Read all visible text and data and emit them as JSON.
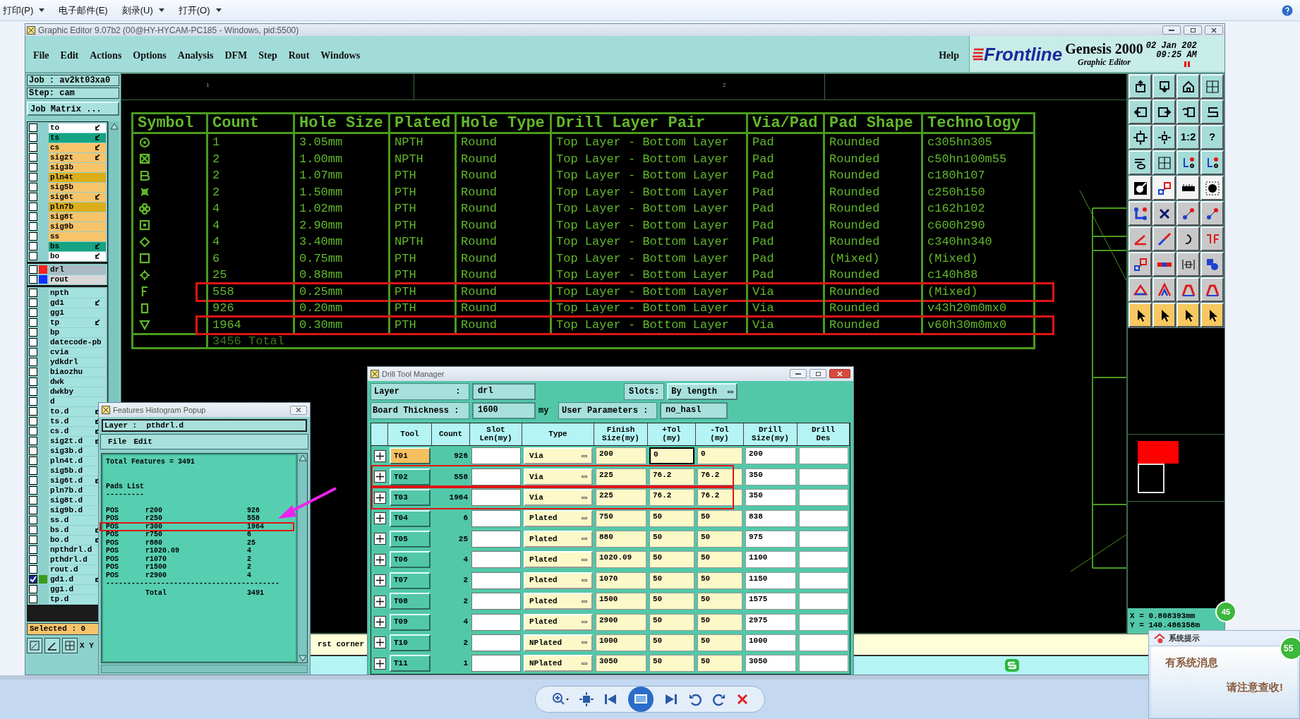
{
  "viewer_toolbar": {
    "items": [
      {
        "label": "打印(P)",
        "dropdown": true
      },
      {
        "label": "电子邮件(E)",
        "dropdown": false
      },
      {
        "label": "刻录(U)",
        "dropdown": true
      },
      {
        "label": "打开(O)",
        "dropdown": true
      }
    ]
  },
  "window": {
    "title": "Graphic Editor 9.07b2 (00@HY-HYCAM-PC185 - Windows, pid:5500)"
  },
  "menu": [
    "File",
    "Edit",
    "Actions",
    "Options",
    "Analysis",
    "DFM",
    "Step",
    "Rout",
    "Windows"
  ],
  "help": "Help",
  "branding": {
    "logo": "Frontline",
    "product": "Genesis 2000",
    "subtitle": "Graphic Editor",
    "date": "02 Jan 202",
    "time": "09:25 AM"
  },
  "job": {
    "job": "Job : av2kt03xa0",
    "step": "Step: cam",
    "matrix_button": "Job Matrix ..."
  },
  "layer_groups": [
    [
      {
        "name": "to",
        "color": "#ffffff",
        "linked": true,
        "checked": false
      },
      {
        "name": "ts",
        "color": "#16a383",
        "linked": true,
        "checked": false
      },
      {
        "name": "cs",
        "color": "#f8c46a",
        "linked": true,
        "checked": false
      },
      {
        "name": "sig2t",
        "color": "#f8c46a",
        "linked": true,
        "checked": false
      },
      {
        "name": "sig3b",
        "color": "#f8c46a",
        "linked": false,
        "checked": false
      },
      {
        "name": "pln4t",
        "color": "#dcae1a",
        "linked": false,
        "checked": false
      },
      {
        "name": "sig5b",
        "color": "#f8c46a",
        "linked": false,
        "checked": false
      },
      {
        "name": "sig6t",
        "color": "#f8c46a",
        "linked": true,
        "checked": false
      },
      {
        "name": "pln7b",
        "color": "#dcae1a",
        "linked": false,
        "checked": false
      },
      {
        "name": "sig8t",
        "color": "#f8c46a",
        "linked": false,
        "checked": false
      },
      {
        "name": "sig9b",
        "color": "#f8c46a",
        "linked": false,
        "checked": false
      },
      {
        "name": "ss",
        "color": "#f8c46a",
        "linked": false,
        "checked": false
      },
      {
        "name": "bs",
        "color": "#16a383",
        "linked": true,
        "checked": false
      },
      {
        "name": "bo",
        "color": "#ffffff",
        "linked": true,
        "checked": false
      }
    ],
    [
      {
        "name": "drl",
        "color": "#a9bcc4",
        "swatch": {
          "color": "#ff2020"
        },
        "linked": false,
        "checked": false
      },
      {
        "name": "rout",
        "color": "#d8d8d8",
        "swatch": {
          "color": "#1030ff"
        },
        "linked": false,
        "checked": false
      }
    ],
    [
      {
        "name": "npth",
        "color": "#a4e2e0",
        "linked": false,
        "checked": false
      },
      {
        "name": "gd1",
        "color": "#a4e2e0",
        "linked": true,
        "checked": false
      },
      {
        "name": "gg1",
        "color": "#a4e2e0",
        "linked": false,
        "checked": false
      },
      {
        "name": "tp",
        "color": "#a4e2e0",
        "linked": true,
        "checked": false
      },
      {
        "name": "bp",
        "color": "#a4e2e0",
        "linked": false,
        "checked": false
      },
      {
        "name": "datecode-pb",
        "color": "#a4e2e0",
        "linked": false,
        "checked": false
      },
      {
        "name": "cvia",
        "color": "#a4e2e0",
        "linked": false,
        "checked": false
      },
      {
        "name": "ydkdrl",
        "color": "#a4e2e0",
        "linked": false,
        "checked": false
      },
      {
        "name": "biaozhu",
        "color": "#a4e2e0",
        "linked": false,
        "checked": false
      },
      {
        "name": "dwk",
        "color": "#a4e2e0",
        "linked": false,
        "checked": false
      },
      {
        "name": "dwkby",
        "color": "#a4e2e0",
        "linked": false,
        "checked": false
      },
      {
        "name": "d",
        "color": "#a4e2e0",
        "linked": false,
        "checked": false
      },
      {
        "name": "to.d",
        "color": "#a4e2e0",
        "linked": true,
        "checked": false
      },
      {
        "name": "ts.d",
        "color": "#a4e2e0",
        "linked": true,
        "checked": false
      },
      {
        "name": "cs.d",
        "color": "#a4e2e0",
        "linked": true,
        "checked": false
      },
      {
        "name": "sig2t.d",
        "color": "#a4e2e0",
        "linked": true,
        "checked": false
      },
      {
        "name": "sig3b.d",
        "color": "#a4e2e0",
        "linked": false,
        "checked": false
      },
      {
        "name": "pln4t.d",
        "color": "#a4e2e0",
        "linked": false,
        "checked": false
      },
      {
        "name": "sig5b.d",
        "color": "#a4e2e0",
        "linked": false,
        "checked": false
      },
      {
        "name": "sig6t.d",
        "color": "#a4e2e0",
        "linked": true,
        "checked": false
      },
      {
        "name": "pln7b.d",
        "color": "#a4e2e0",
        "linked": false,
        "checked": false
      },
      {
        "name": "sig8t.d",
        "color": "#a4e2e0",
        "linked": false,
        "checked": false
      },
      {
        "name": "sig9b.d",
        "color": "#a4e2e0",
        "linked": false,
        "checked": false
      },
      {
        "name": "ss.d",
        "color": "#a4e2e0",
        "linked": false,
        "checked": false
      },
      {
        "name": "bs.d",
        "color": "#a4e2e0",
        "linked": true,
        "checked": false
      },
      {
        "name": "bo.d",
        "color": "#a4e2e0",
        "linked": true,
        "checked": false
      },
      {
        "name": "npthdrl.d",
        "color": "#a4e2e0",
        "linked": false,
        "checked": false
      },
      {
        "name": "pthdrl.d",
        "color": "#a4e2e0",
        "linked": false,
        "checked": false
      },
      {
        "name": "rout.d",
        "color": "#a4e2e0",
        "linked": false,
        "checked": false
      },
      {
        "name": "gd1.d",
        "color": "#a4e2e0",
        "swatch": {
          "color": "#3a9a1a"
        },
        "linked": true,
        "checked": true
      },
      {
        "name": "gg1.d",
        "color": "#a4e2e0",
        "linked": false,
        "checked": false
      },
      {
        "name": "tp.d",
        "color": "#a4e2e0",
        "linked": false,
        "checked": false
      }
    ]
  ],
  "selected_status": "Selected : 0",
  "xy_label": "X Y",
  "ruler": [
    "1",
    "2"
  ],
  "drill_table": {
    "columns": [
      "Symbol",
      "Count",
      "Hole Size",
      "Plated",
      "Hole Type",
      "Drill Layer Pair",
      "Via/Pad",
      "Pad Shape",
      "Technology"
    ],
    "rows": [
      {
        "kind": "ring",
        "cells": [
          "",
          "1",
          "3.05mm",
          "NPTH",
          "Round",
          "Top Layer - Bottom Layer",
          "Pad",
          "Rounded",
          "c305hn305"
        ],
        "highlighted": false
      },
      {
        "kind": "crossed-square",
        "cells": [
          "",
          "2",
          "1.00mm",
          "NPTH",
          "Round",
          "Top Layer - Bottom Layer",
          "Pad",
          "Rounded",
          "c50hn100m55"
        ],
        "highlighted": false
      },
      {
        "kind": "b-shape",
        "cells": [
          "",
          "2",
          "1.07mm",
          "PTH",
          "Round",
          "Top Layer - Bottom Layer",
          "Pad",
          "Rounded",
          "c180h107"
        ],
        "highlighted": false
      },
      {
        "kind": "cross",
        "cells": [
          "",
          "2",
          "1.50mm",
          "PTH",
          "Round",
          "Top Layer - Bottom Layer",
          "Pad",
          "Rounded",
          "c250h150"
        ],
        "highlighted": false
      },
      {
        "kind": "clover",
        "cells": [
          "",
          "4",
          "1.02mm",
          "PTH",
          "Round",
          "Top Layer - Bottom Layer",
          "Pad",
          "Rounded",
          "c162h102"
        ],
        "highlighted": false
      },
      {
        "kind": "dotted-square",
        "cells": [
          "",
          "4",
          "2.90mm",
          "PTH",
          "Round",
          "Top Layer - Bottom Layer",
          "Pad",
          "Rounded",
          "c600h290"
        ],
        "highlighted": false
      },
      {
        "kind": "diamond",
        "cells": [
          "",
          "4",
          "3.40mm",
          "NPTH",
          "Round",
          "Top Layer - Bottom Layer",
          "Pad",
          "Rounded",
          "c340hn340"
        ],
        "highlighted": false
      },
      {
        "kind": "square",
        "cells": [
          "",
          "6",
          "0.75mm",
          "PTH",
          "Round",
          "Top Layer - Bottom Layer",
          "Pad",
          "(Mixed)",
          "(Mixed)"
        ],
        "highlighted": false
      },
      {
        "kind": "star",
        "cells": [
          "",
          "25",
          "0.88mm",
          "PTH",
          "Round",
          "Top Layer - Bottom Layer",
          "Pad",
          "Rounded",
          "c140h88"
        ],
        "highlighted": false
      },
      {
        "kind": "f-shape",
        "cells": [
          "",
          "558",
          "0.25mm",
          "PTH",
          "Round",
          "Top Layer - Bottom Layer",
          "Via",
          "Rounded",
          "(Mixed)"
        ],
        "highlighted": true
      },
      {
        "kind": "rectangle",
        "cells": [
          "",
          "926",
          "0.20mm",
          "PTH",
          "Round",
          "Top Layer - Bottom Layer",
          "Via",
          "Rounded",
          "v43h20m0mx0"
        ],
        "highlighted": false
      },
      {
        "kind": "triangle",
        "cells": [
          "",
          "1964",
          "0.30mm",
          "PTH",
          "Round",
          "Top Layer - Bottom Layer",
          "Via",
          "Rounded",
          "v60h30m0mx0"
        ],
        "highlighted": true
      }
    ],
    "total": "3456 Total"
  },
  "toolbar_labels": [
    "1:2",
    "?"
  ],
  "coordinates": {
    "x": "X = 0.808393mm",
    "y": "Y = 140.486358m",
    "badge": "45"
  },
  "status_text": "rst corner",
  "histogram": {
    "title": "Features Histogram Popup",
    "layer": "Layer :  pthdrl.d",
    "menu": [
      "File",
      "Edit"
    ],
    "total_features": "Total Features = 3491",
    "list_title": "Pads List",
    "underline": "---------",
    "rows": [
      {
        "type": "POS",
        "symbol": "r200",
        "count": "926",
        "highlighted": false
      },
      {
        "type": "POS",
        "symbol": "r250",
        "count": "558",
        "highlighted": false
      },
      {
        "type": "POS",
        "symbol": "r300",
        "count": "1964",
        "highlighted": true
      },
      {
        "type": "POS",
        "symbol": "r750",
        "count": "6",
        "highlighted": false
      },
      {
        "type": "POS",
        "symbol": "r880",
        "count": "25",
        "highlighted": false
      },
      {
        "type": "POS",
        "symbol": "r1020.09",
        "count": "4",
        "highlighted": false
      },
      {
        "type": "POS",
        "symbol": "r1070",
        "count": "2",
        "highlighted": false
      },
      {
        "type": "POS",
        "symbol": "r1500",
        "count": "2",
        "highlighted": false
      },
      {
        "type": "POS",
        "symbol": "r2900",
        "count": "4",
        "highlighted": false
      }
    ],
    "separator": "-----------------------------------------",
    "total_label": "Total",
    "total_value": "3491"
  },
  "drill_manager": {
    "title": "Drill Tool Manager",
    "layer_label": "Layer           :",
    "layer_value": "drl",
    "slots_label": "Slots:",
    "slots_value": "By length",
    "thickness_label": "Board Thickness :",
    "thickness_value": "1600",
    "thickness_unit": "my",
    "params_label": "User Parameters :",
    "params_value": "no_hasl",
    "columns": [
      "Tool",
      "Count",
      "Slot\nLen(my)",
      "Type",
      "Finish\nSize(my)",
      "+Tol\n(my)",
      "-Tol\n(my)",
      "Drill\nSize(my)",
      "Drill\nDes"
    ],
    "rows": [
      {
        "tool": "T01",
        "count": "926",
        "type": "Via",
        "finish": "200",
        "plus_tol": "0",
        "minus_tol": "0",
        "drill": "200",
        "selected": true,
        "highlighted": false
      },
      {
        "tool": "T02",
        "count": "558",
        "type": "Via",
        "finish": "225",
        "plus_tol": "76.2",
        "minus_tol": "76.2",
        "drill": "350",
        "selected": false,
        "highlighted": true
      },
      {
        "tool": "T03",
        "count": "1964",
        "type": "Via",
        "finish": "225",
        "plus_tol": "76.2",
        "minus_tol": "76.2",
        "drill": "350",
        "selected": false,
        "highlighted": true
      },
      {
        "tool": "T04",
        "count": "6",
        "type": "Plated",
        "finish": "750",
        "plus_tol": "50",
        "minus_tol": "50",
        "drill": "838",
        "selected": false,
        "highlighted": false
      },
      {
        "tool": "T05",
        "count": "25",
        "type": "Plated",
        "finish": "880",
        "plus_tol": "50",
        "minus_tol": "50",
        "drill": "975",
        "selected": false,
        "highlighted": false
      },
      {
        "tool": "T06",
        "count": "4",
        "type": "Plated",
        "finish": "1020.09",
        "plus_tol": "50",
        "minus_tol": "50",
        "drill": "1100",
        "selected": false,
        "highlighted": false
      },
      {
        "tool": "T07",
        "count": "2",
        "type": "Plated",
        "finish": "1070",
        "plus_tol": "50",
        "minus_tol": "50",
        "drill": "1150",
        "selected": false,
        "highlighted": false
      },
      {
        "tool": "T08",
        "count": "2",
        "type": "Plated",
        "finish": "1500",
        "plus_tol": "50",
        "minus_tol": "50",
        "drill": "1575",
        "selected": false,
        "highlighted": false
      },
      {
        "tool": "T09",
        "count": "4",
        "type": "Plated",
        "finish": "2900",
        "plus_tol": "50",
        "minus_tol": "50",
        "drill": "2975",
        "selected": false,
        "highlighted": false
      },
      {
        "tool": "T10",
        "count": "2",
        "type": "NPlated",
        "finish": "1000",
        "plus_tol": "50",
        "minus_tol": "50",
        "drill": "1000",
        "selected": false,
        "highlighted": false
      },
      {
        "tool": "T11",
        "count": "1",
        "type": "NPlated",
        "finish": "3050",
        "plus_tol": "50",
        "minus_tol": "50",
        "drill": "3050",
        "selected": false,
        "highlighted": false
      }
    ]
  },
  "notification": {
    "title": "系统提示",
    "line1": "有系统消息",
    "line2": "请注意查收!",
    "badge": "55"
  }
}
